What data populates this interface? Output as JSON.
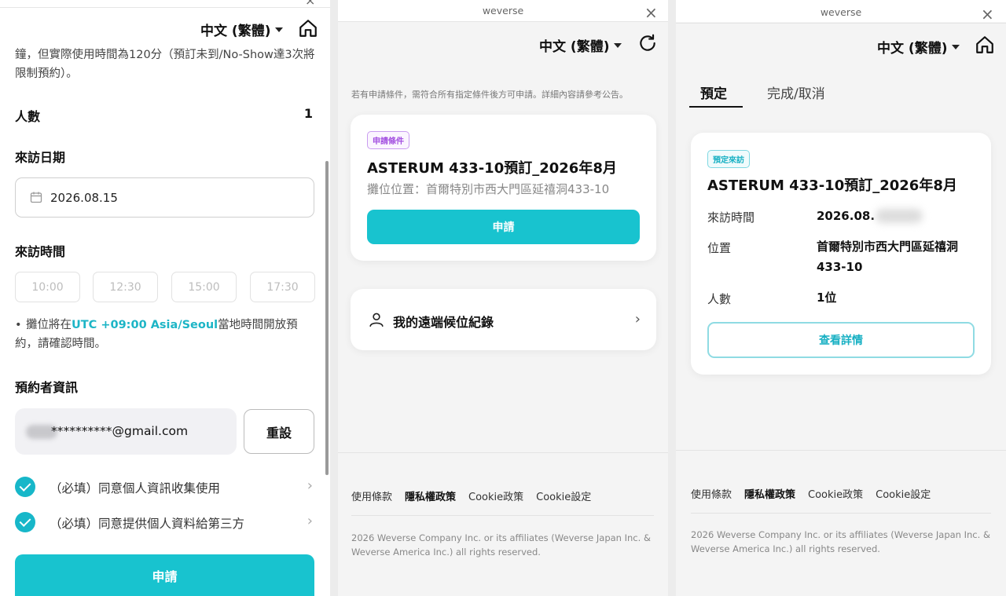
{
  "common": {
    "language": "中文 (繁體)",
    "site_name": "weverse",
    "close": "×"
  },
  "panel1": {
    "note": "鐘，但實際使用時間為120分（預訂未到/No-Show達3次將限制預約）。",
    "people_label": "人數",
    "people_value": "1",
    "date_label": "來訪日期",
    "date_value": "2026.08.15",
    "time_label": "來訪時間",
    "time_slots": [
      "10:00",
      "12:30",
      "15:00",
      "17:30"
    ],
    "tz_note_prefix": "攤位將在",
    "tz_note_tz": "UTC +09:00 Asia/Seoul",
    "tz_note_suffix": "當地時間開放預約，請確認時間。",
    "booker_label": "預約者資訊",
    "email": "**********@gmail.com",
    "reset_label": "重設",
    "consents": [
      "（必填）同意個人資訊收集使用",
      "（必填）同意提供個人資料給第三方"
    ],
    "apply_label": "申請"
  },
  "panel2": {
    "notice": "若有申請條件，需符合所有指定條件後方可申請。詳細內容請參考公告。",
    "tag": "申請條件",
    "title": "ASTERUM 433-10預訂_2026年8月",
    "location": "攤位位置：首爾特別市西大門區延禧洞433-10",
    "apply_label": "申請",
    "waitlist_label": "我的遠端候位紀錄"
  },
  "panel3": {
    "tab_reserved": "預定",
    "tab_done": "完成/取消",
    "tag": "預定來訪",
    "title": "ASTERUM 433-10預訂_2026年8月",
    "visit_time_label": "來訪時間",
    "visit_time_value": "2026.08.",
    "location_label": "位置",
    "location_value_1": "首爾特別市西大門區延禧洞",
    "location_value_2": "433-10",
    "people_label": "人數",
    "people_value": "1位",
    "detail_label": "查看詳情"
  },
  "footer": {
    "terms": "使用條款",
    "privacy": "隱私權政策",
    "cookie_policy": "Cookie政策",
    "cookie_settings": "Cookie設定",
    "copyright": "2026 Weverse Company Inc. or its affiliates (Weverse Japan Inc. & Weverse America Inc.) all rights reserved."
  },
  "colors": {
    "accent": "#18c3cf",
    "tag_purple": "#a24ee0"
  }
}
